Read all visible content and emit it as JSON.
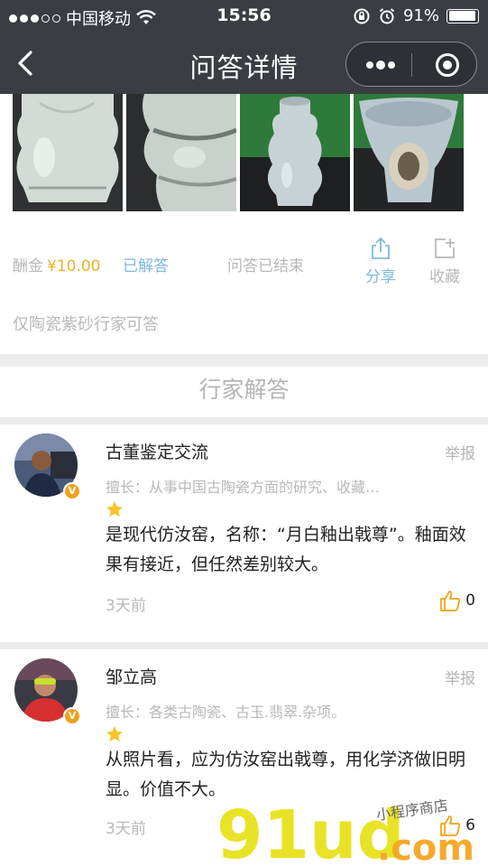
{
  "status_bar": {
    "carrier": "中国移动",
    "time": "15:56",
    "battery": "91%",
    "battery_level": 0.91
  },
  "nav": {
    "title": "问答详情"
  },
  "question": {
    "reward_label": "酬金",
    "reward_amount": "¥10.00",
    "answered_label": "已解答",
    "closed_label": "问答已结束",
    "share_label": "分享",
    "favorite_label": "收藏",
    "restriction": "仅陶瓷紫砂行家可答"
  },
  "section_title": "行家解答",
  "answers": [
    {
      "name": "古董鉴定交流",
      "report": "举报",
      "expertise": "擅长：从事中国古陶瓷方面的研究、收藏…",
      "content": "是现代仿汝窑，名称：“月白釉出戟尊”。釉面效果有接近，但任然差别较大。",
      "time": "3天前",
      "likes": "0"
    },
    {
      "name": "邹立高",
      "report": "举报",
      "expertise": "擅长：各类古陶瓷、古玉.翡翠.杂项。",
      "content": "从照片看，应为仿汝窑出戟尊，用化学济做旧明显。价值不大。",
      "time": "3天前",
      "likes": "6"
    }
  ],
  "watermark": {
    "brand": "91ud",
    "tld": ".com",
    "tagline": "小程序商店"
  },
  "colors": {
    "nav_bg": "#3b3d45",
    "accent_blue": "#7fb9dc",
    "reward_gold": "#e7b526",
    "badge_orange": "#f0a21b",
    "watermark_yellow": "#e8e21c",
    "watermark_orange": "#f5a623"
  }
}
